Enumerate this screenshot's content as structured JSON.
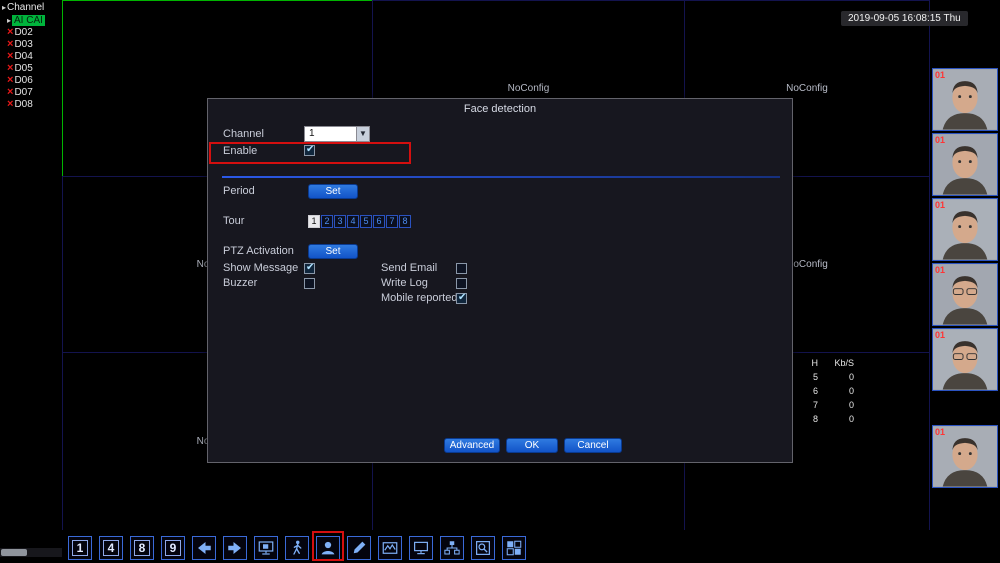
{
  "header": {
    "timestamp": "2019-09-05 16:08:15 Thu"
  },
  "sidebar": {
    "title": "Channel",
    "items": [
      {
        "label": "AI CAI"
      },
      {
        "label": "D02"
      },
      {
        "label": "D03"
      },
      {
        "label": "D04"
      },
      {
        "label": "D05"
      },
      {
        "label": "D06"
      },
      {
        "label": "D07"
      },
      {
        "label": "D08"
      }
    ]
  },
  "video_grid": {
    "no_config": "NoConfig",
    "stats": {
      "headers": [
        "H",
        "Kb/S"
      ],
      "rows": [
        [
          "5",
          "0"
        ],
        [
          "6",
          "0"
        ],
        [
          "7",
          "0"
        ],
        [
          "8",
          "0"
        ]
      ]
    }
  },
  "face_panel": {
    "channel_badge": "01"
  },
  "dialog": {
    "title": "Face detection",
    "fields": {
      "channel_label": "Channel",
      "channel_value": "1",
      "enable_label": "Enable",
      "period_label": "Period",
      "period_set": "Set",
      "tour_label": "Tour",
      "tour_buttons": [
        "1",
        "2",
        "3",
        "4",
        "5",
        "6",
        "7",
        "8"
      ],
      "tour_selected": "1",
      "ptz_label": "PTZ Activation",
      "ptz_set": "Set",
      "show_message_label": "Show Message",
      "send_email_label": "Send Email",
      "buzzer_label": "Buzzer",
      "write_log_label": "Write Log",
      "mobile_reported_label": "Mobile reported"
    },
    "state": {
      "enable": true,
      "show_message": true,
      "send_email": false,
      "buzzer": false,
      "write_log": false,
      "mobile_reported": true
    },
    "buttons": {
      "advanced": "Advanced",
      "ok": "OK",
      "cancel": "Cancel"
    }
  },
  "toolbar": {
    "view_labels": {
      "v1": "1",
      "v4": "4",
      "v8": "8",
      "v9": "9"
    }
  }
}
